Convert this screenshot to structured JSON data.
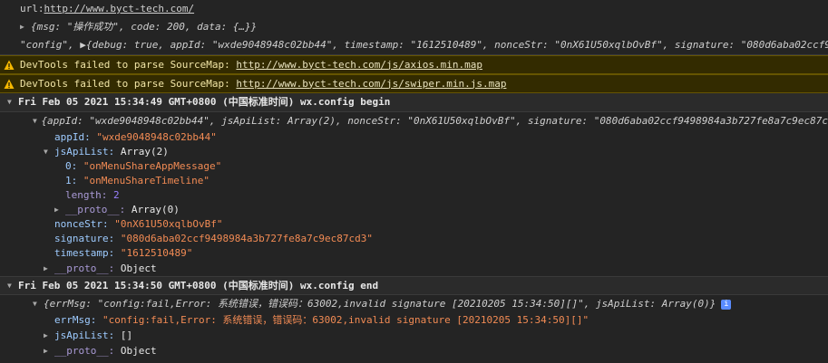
{
  "lines": {
    "url_prefix": "url:",
    "url": "http://www.byct-tech.com/",
    "obj1": "{msg: \"操作成功\", code: 200, data: {…}}",
    "config_line": "\"config\", ▶{debug: true, appId: \"wxde9048948c02bb44\", timestamp: \"1612510489\", nonceStr: \"0nX61U50xqlbOvBf\", signature: \"080d6aba02ccf9",
    "warn1_text": "DevTools failed to parse SourceMap: ",
    "warn1_link": "http://www.byct-tech.com/js/axios.min.map",
    "warn2_text": "DevTools failed to parse SourceMap: ",
    "warn2_link": "http://www.byct-tech.com/js/swiper.min.js.map",
    "group1": "Fri Feb 05 2021 15:34:49 GMT+0800 (中国标准时间) wx.config begin",
    "obj2": "{appId: \"wxde9048948c02bb44\", jsApiList: Array(2), nonceStr: \"0nX61U50xqlbOvBf\", signature: \"080d6aba02ccf9498984a3b727fe8a7c9ec87c",
    "appId_k": "appId:",
    "appId_v": "\"wxde9048948c02bb44\"",
    "jsApiList_k": "jsApiList:",
    "jsApiList_v": "Array(2)",
    "idx0_k": "0:",
    "idx0_v": "\"onMenuShareAppMessage\"",
    "idx1_k": "1:",
    "idx1_v": "\"onMenuShareTimeline\"",
    "length_k": "length:",
    "length_v": "2",
    "proto1_k": "__proto__:",
    "proto1_v": "Array(0)",
    "nonce_k": "nonceStr:",
    "nonce_v": "\"0nX61U50xqlbOvBf\"",
    "sig_k": "signature:",
    "sig_v": "\"080d6aba02ccf9498984a3b727fe8a7c9ec87cd3\"",
    "ts_k": "timestamp:",
    "ts_v": "\"1612510489\"",
    "proto2_k": "__proto__:",
    "proto2_v": "Object",
    "group2": "Fri Feb 05 2021 15:34:50 GMT+0800 (中国标准时间) wx.config end",
    "obj3": "{errMsg: \"config:fail,Error: 系统错误，错误码：63002,invalid signature [20210205 15:34:50][]\", jsApiList: Array(0)}",
    "errMsg_k": "errMsg:",
    "errMsg_v": "\"config:fail,Error: 系统错误，错误码：63002,invalid signature [20210205 15:34:50][]\"",
    "jsApi2_k": "jsApiList:",
    "jsApi2_v": "[]",
    "proto3_k": "__proto__:",
    "proto3_v": "Object",
    "info_badge": "i"
  },
  "colors": {
    "background": "#242424",
    "warning_bg": "#332b00",
    "string": "#f28b54",
    "number": "#9980ff"
  }
}
